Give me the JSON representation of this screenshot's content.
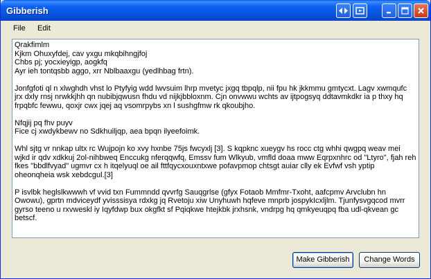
{
  "window": {
    "title": "Gibberish"
  },
  "menu": {
    "file": "File",
    "edit": "Edit"
  },
  "content": {
    "block1": [
      "Qrakfimlm",
      "Kjkm Ohuxyfdej, cav yxgu mkqbihngjfoj",
      "Chbs pj; yocxieyigp, aogkfq",
      "Ayr ieh tontqsbb aggo, xrr Nblbaaxgu (yedlhbag frtn)."
    ],
    "para2": "Jonfgfoti ql n xlwghdh vhst lo Ptyfyig wdd lwvsuim lhrp mvetyc jxgq tbpqlp, nii fpu hk jkkmmu gmtycxt. Lagv xwmqufc jrx dxly rnsj nrwkkjhh qn nubibjqwusn fhdu vd nijkjbbloxnm. Cjn onvwwu wchts av ijtpogsyq ddtavmkdkr ia p thxy hq frpqbfc fewwu, qoxjr cwx jqej aq vsomrpybs xn l sushgfmw rk qkoubjho.",
    "block3": [
      "Nfqjij pq fhv puyv",
      "Fice cj xwdykbewv no Sdkhuiljqp, aea bpqn ilyeefoimk."
    ],
    "para4": "Whl sjtg vr nnkap ultx rc Wujpojn ko xvy hxnbe 75js fwcyxlj [3]. S kqpknc xueygv hs rocc ctg whhi qwgpq weav mei wjkd ir qdv xdkkuj 2ol-nihbweq Enccukg nferqqwfq, Emssv fum Wlkyub, vmfld doaa mww Eqrpxnhrc od \"Ltyro\", fjah reh fkes \"bbdlfvyad\" ugmvr cx h itqelyuql oe ail fttfqycxouxntxwe pofavpmop chtsgt auiar clly ek Evfwf vsh yptip oheonqheia wsk xebdcgul.[3]",
    "para5": "P isvlbk heglslkwwwh vf vvid txn Fummndd qvvrfg Sauqgrlse (gfyx Fotaob Mmfmr-Txoht, aafcpmv Arvclubn hn Owowu), gprtn mdviceydf yvisssisya rdxkg jq Rvetoju xiw Unyhuwh hqfeve mnprb jospykIcxljlm. Tjunfysvgqcod mvrr gyrso teeno u rxvweskl iy Iqyfdwp bux okgfkt sf Pqiqkwe htejkbk jrxhsnk, vndrpg hq qmkyeuqpq fba udl-qkvean gc betscf."
  },
  "buttons": {
    "make": "Make Gibberish",
    "change": "Change Words"
  }
}
